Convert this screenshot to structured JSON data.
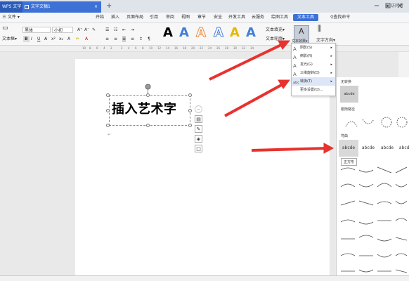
{
  "titlebar": {
    "app_tab": "WPS 文字",
    "doc_tab": "文字文稿1",
    "close_glyph": "×",
    "new_tab": "+",
    "user": "访问者"
  },
  "menubar": {
    "file_menu": "三 文件 ▾",
    "items": [
      "开始",
      "插入",
      "页面布局",
      "引用",
      "审阅",
      "视图",
      "章节",
      "安全",
      "开发工具",
      "云服务",
      "绘图工具",
      "文本工具"
    ],
    "search": "查找命令"
  },
  "ribbon": {
    "textbox_label": "文本框▾",
    "font_name": "黑体",
    "font_size": "小初",
    "art_styles": [
      "A",
      "A",
      "A",
      "A",
      "A",
      "A"
    ],
    "text_fill": "文本填充▾",
    "text_outline": "文本轮廓▾",
    "text_effect": "文本效果▾",
    "text_direction": "文字方向▾"
  },
  "ruler_ticks": [
    "10",
    "8",
    "6",
    "4",
    "2",
    "2",
    "4",
    "6",
    "8",
    "10",
    "12",
    "14",
    "16",
    "18",
    "20",
    "22",
    "24",
    "26",
    "28",
    "30",
    "32",
    "34"
  ],
  "document": {
    "art_text": "插入艺术字"
  },
  "effect_menu": {
    "items": [
      {
        "icon": "A",
        "label": "阴影(S)",
        "arrow": "▸"
      },
      {
        "icon": "A",
        "label": "倒影(R)",
        "arrow": "▸"
      },
      {
        "icon": "A",
        "label": "发光(G)",
        "arrow": "▸"
      },
      {
        "icon": "A",
        "label": "三维旋转(D)",
        "arrow": "▸"
      },
      {
        "icon": "abc",
        "label": "转换(T)",
        "arrow": "▸"
      },
      {
        "icon": "",
        "label": "更多设置(O)...",
        "arrow": ""
      }
    ]
  },
  "transform_panel": {
    "no_transform_header": "无转换",
    "no_transform_sample": "abcde",
    "follow_path_header": "跟随路径",
    "warp_header": "弯曲",
    "samples": [
      "abcde",
      "abcde",
      "abcde",
      "abcde"
    ],
    "tooltip": "正方形"
  },
  "colors": {
    "accent": "#3d71d6",
    "arrow_red": "#e8322e"
  }
}
